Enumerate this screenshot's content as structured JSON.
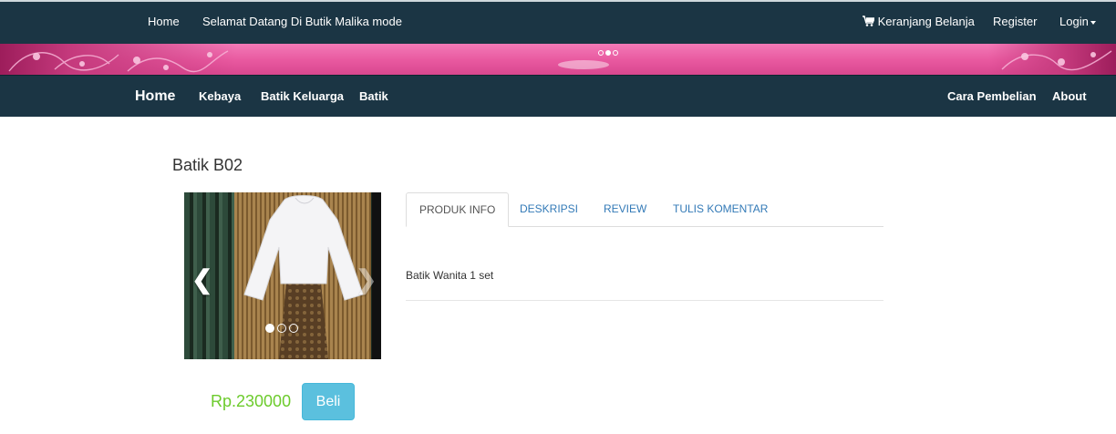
{
  "topbar": {
    "home": "Home",
    "welcome": "Selamat Datang Di Butik Malika mode",
    "cart": "Keranjang Belanja",
    "register": "Register",
    "login": "Login"
  },
  "mainnav": {
    "brand": "Home",
    "items": [
      "Kebaya",
      "Batik Keluarga",
      "Batik"
    ],
    "right_items": [
      "Cara Pembelian",
      "About"
    ]
  },
  "product": {
    "title": "Batik B02",
    "tabs": [
      "PRODUK INFO",
      "DESKRIPSI",
      "REVIEW",
      "TULIS KOMENTAR"
    ],
    "active_tab": "PRODUK INFO",
    "info_text": "Batik Wanita 1 set",
    "price": "Rp.230000",
    "buy_label": "Beli"
  },
  "carousel": {
    "slide_count": 3,
    "active_slide": 1,
    "prev_icon": "chevron-left-icon",
    "next_icon": "chevron-right-icon"
  },
  "colors": {
    "navbar": "#1b3544",
    "banner_pink": "#e8589f",
    "price_green": "#6ccb2c",
    "button_info": "#5bc0de",
    "link_blue": "#337ab7"
  }
}
